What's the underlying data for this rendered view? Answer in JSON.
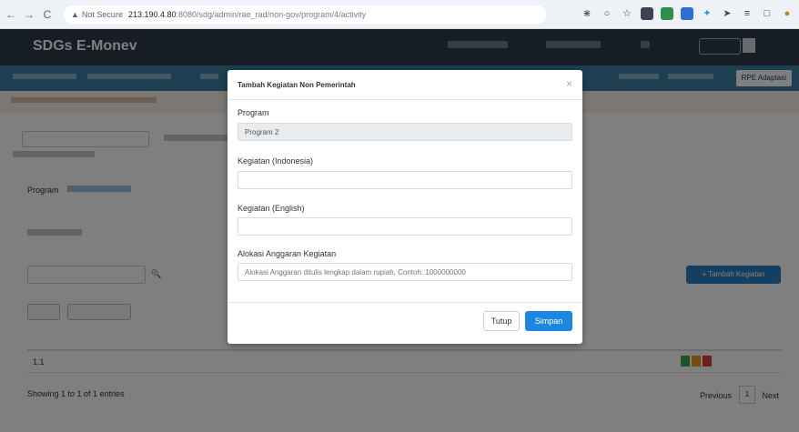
{
  "browser": {
    "back": "←",
    "forward": "→",
    "reload": "C",
    "security_label": "Not Secure",
    "url_host": "213.190.4.80",
    "url_path": ":8080/sdg/admin/rae_rad/non-gov/program/4/activity"
  },
  "app": {
    "brand": "SDGs E-Monev",
    "nav_active": "RPE Adaptasi",
    "add_activity_button": "+ Tambah Kegiatan",
    "filter_program_label": "Program",
    "table_first_row_index": "1.1",
    "showing_text": "Showing 1 to 1 of 1 entries",
    "pager_previous": "Previous",
    "pager_current": "1",
    "pager_next": "Next"
  },
  "modal": {
    "title": "Tambah Kegiatan Non Pemerintah",
    "close_symbol": "×",
    "fields": {
      "program_label": "Program",
      "program_value": "Program 2",
      "kegiatan_id_label": "Kegiatan (Indonesia)",
      "kegiatan_id_value": "",
      "kegiatan_en_label": "Kegiatan (English)",
      "kegiatan_en_value": "",
      "alokasi_label": "Alokasi Anggaran Kegiatan",
      "alokasi_placeholder": "Alokasi Anggaran ditulis lengkap dalam rupiah, Contoh: 1000000000"
    },
    "buttons": {
      "cancel": "Tutup",
      "save": "Simpan"
    }
  },
  "colors": {
    "header_bg": "#2f3b48",
    "nav_bg": "#3d7ea3",
    "primary": "#1f86e0",
    "readonly_bg": "#e9ecef"
  }
}
